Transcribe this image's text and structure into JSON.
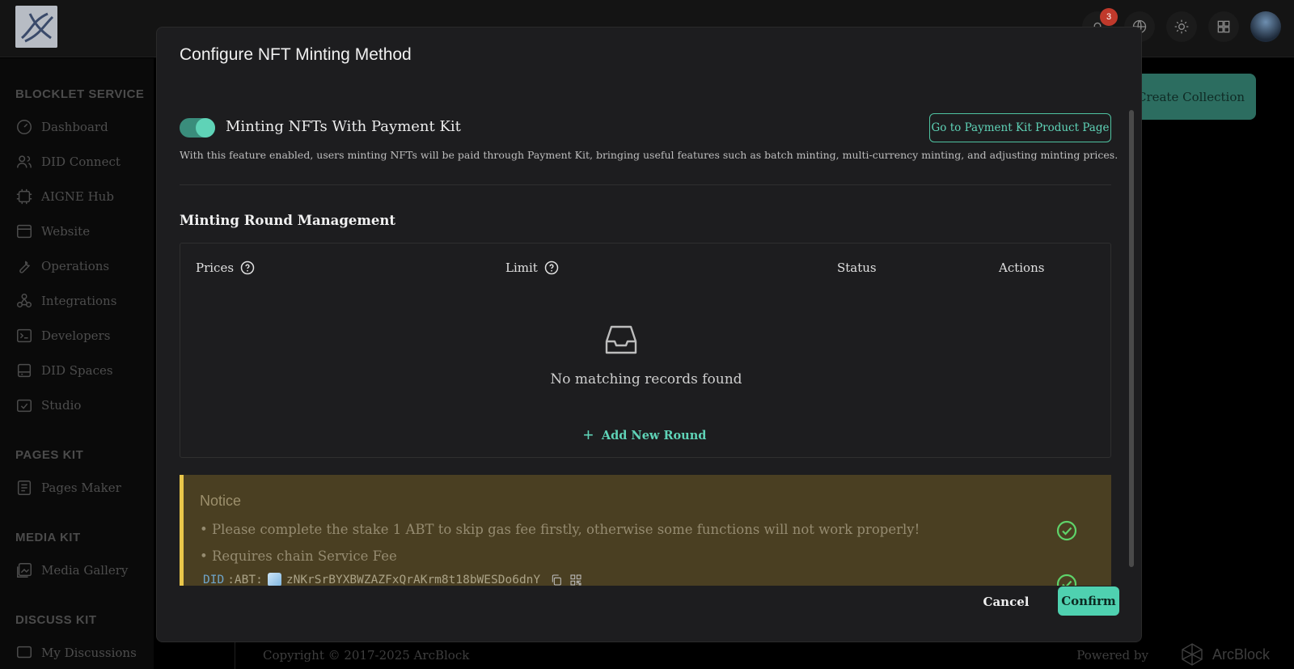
{
  "background": {
    "notification_count": "3",
    "sidebar": {
      "sections": [
        {
          "title": "BLOCKLET SERVICE",
          "items": [
            "Dashboard",
            "DID Connect",
            "AIGNE Hub",
            "Website",
            "Operations",
            "Integrations",
            "Developers",
            "DID Spaces",
            "Studio"
          ]
        },
        {
          "title": "PAGES KIT",
          "items": [
            "Pages Maker"
          ]
        },
        {
          "title": "MEDIA KIT",
          "items": [
            "Media Gallery"
          ]
        },
        {
          "title": "DISCUSS KIT",
          "items": [
            "My Discussions"
          ]
        }
      ]
    },
    "create_collection_label": "Create Collection",
    "footer": {
      "copyright": "Copyright © 2017-2025  ArcBlock",
      "powered_by": "Powered by",
      "brand": "ArcBlock"
    }
  },
  "modal": {
    "title": "Configure NFT Minting Method",
    "toggle": {
      "label": "Minting NFTs With Payment Kit",
      "enabled": true
    },
    "description": "With this feature enabled, users minting NFTs will be paid through Payment Kit, bringing useful features such as batch minting, multi-currency minting, and adjusting minting prices.",
    "product_page_button": "Go to Payment Kit Product Page",
    "round_section": {
      "title": "Minting Round Management",
      "columns": [
        "Prices",
        "Limit",
        "Status",
        "Actions"
      ],
      "empty_text": "No matching records found",
      "add_label": "Add New Round"
    },
    "notice": {
      "title": "Notice",
      "items": [
        "• Please complete the stake 1 ABT to skip gas fee firstly, otherwise some functions will not work properly!",
        "• Requires chain Service Fee"
      ],
      "did_prefix": "DID",
      "did_chain": ":ABT:",
      "did_value": "zNKrSrBYXBWZAZFxQrAKrm8t18bWESDo6dnY"
    },
    "cancel_label": "Cancel",
    "confirm_label": "Confirm"
  },
  "colors": {
    "accent": "#4fd1b0",
    "notice_bg": "#4a3f22",
    "notice_border": "#e9c64a",
    "check": "#5fd36a"
  }
}
